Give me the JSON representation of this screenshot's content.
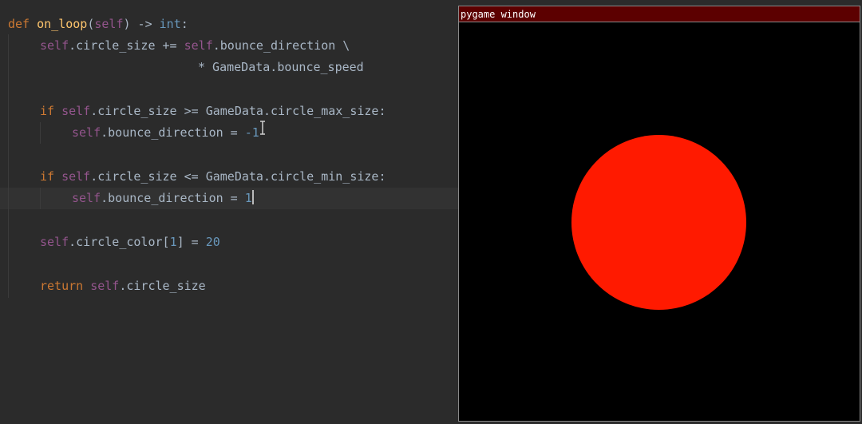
{
  "editor": {
    "lines": {
      "l1": {
        "kw": "def ",
        "fn": "on_loop",
        "p1": "(",
        "self": "self",
        "p2": ") -> ",
        "ret": "int",
        "p3": ":"
      },
      "l2": {
        "self": "self",
        "t1": ".circle_size += ",
        "self2": "self",
        "t2": ".bounce_direction \\"
      },
      "l3": {
        "t": "* GameData.bounce_speed"
      },
      "l5": {
        "kw": "if ",
        "self": "self",
        "t": ".circle_size >= GameData.circle_max_size:"
      },
      "l6": {
        "self": "self",
        "t": ".bounce_direction = ",
        "num": "-1"
      },
      "l8": {
        "kw": "if ",
        "self": "self",
        "t": ".circle_size <= GameData.circle_min_size:"
      },
      "l9": {
        "self": "self",
        "t": ".bounce_direction = ",
        "num": "1"
      },
      "l11": {
        "self": "self",
        "t1": ".circle_color[",
        "num1": "1",
        "t2": "] = ",
        "num2": "20"
      },
      "l13": {
        "kw": "return ",
        "self": "self",
        "t": ".circle_size"
      }
    }
  },
  "pygame_window": {
    "title": "pygame window",
    "titlebar_color": "#5c0000",
    "background_color": "#000000",
    "circle_color": "#ff1a00"
  }
}
